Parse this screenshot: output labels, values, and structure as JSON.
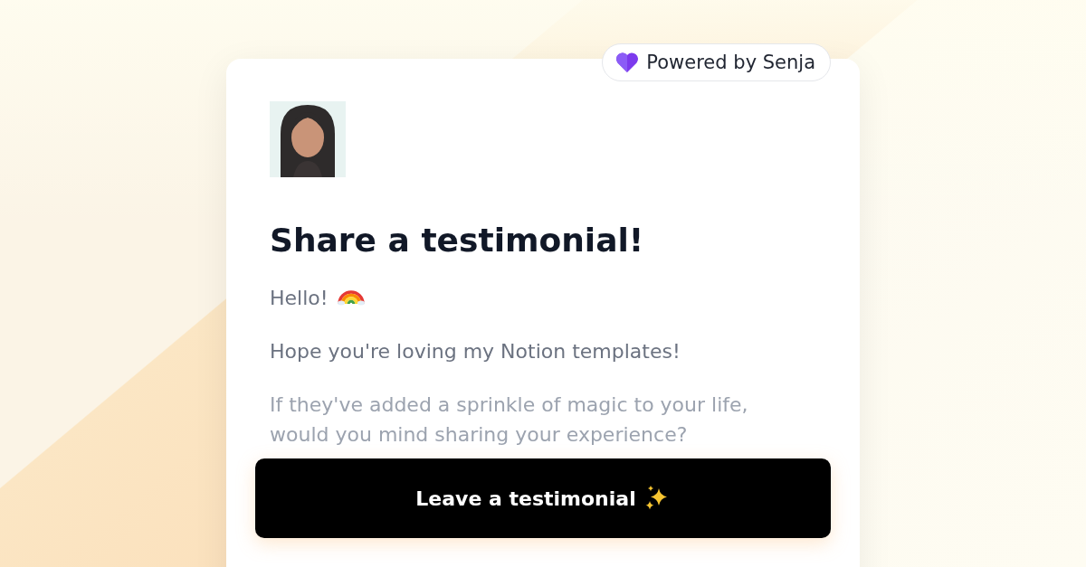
{
  "badge": {
    "label": "Powered by Senja"
  },
  "card": {
    "title": "Share a testimonial!",
    "paragraphs": [
      {
        "text": "Hello!",
        "kind": "greeting"
      },
      {
        "text": "Hope you're loving my Notion templates!",
        "kind": "text"
      },
      {
        "text": "If they've added a sprinkle of magic to your life, would you mind sharing your experience?",
        "kind": "text"
      }
    ],
    "button": {
      "label": "Leave a testimonial"
    }
  }
}
